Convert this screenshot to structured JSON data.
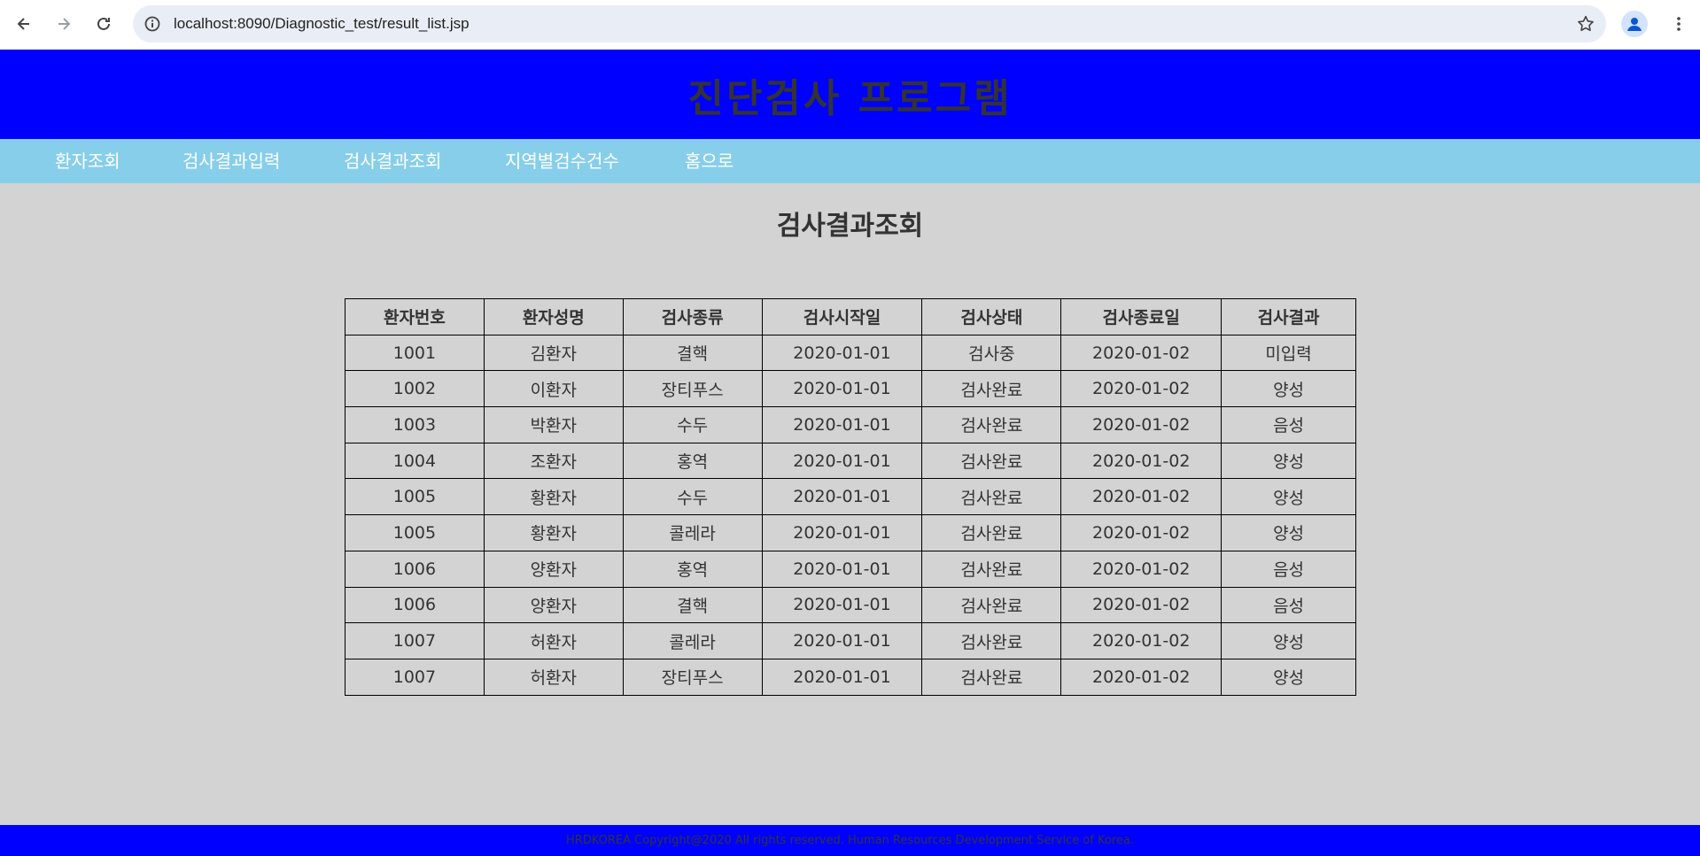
{
  "browser": {
    "url": "localhost:8090/Diagnostic_test/result_list.jsp"
  },
  "header": {
    "title": "진단검사 프로그램"
  },
  "nav": {
    "items": [
      "환자조회",
      "검사결과입력",
      "검사결과조회",
      "지역별검수건수",
      "홈으로"
    ]
  },
  "main": {
    "title": "검사결과조회",
    "table": {
      "headers": [
        "환자번호",
        "환자성명",
        "검사종류",
        "검사시작일",
        "검사상태",
        "검사종료일",
        "검사결과"
      ],
      "rows": [
        [
          "1001",
          "김환자",
          "결핵",
          "2020-01-01",
          "검사중",
          "2020-01-02",
          "미입력"
        ],
        [
          "1002",
          "이환자",
          "장티푸스",
          "2020-01-01",
          "검사완료",
          "2020-01-02",
          "양성"
        ],
        [
          "1003",
          "박환자",
          "수두",
          "2020-01-01",
          "검사완료",
          "2020-01-02",
          "음성"
        ],
        [
          "1004",
          "조환자",
          "홍역",
          "2020-01-01",
          "검사완료",
          "2020-01-02",
          "양성"
        ],
        [
          "1005",
          "황환자",
          "수두",
          "2020-01-01",
          "검사완료",
          "2020-01-02",
          "양성"
        ],
        [
          "1005",
          "황환자",
          "콜레라",
          "2020-01-01",
          "검사완료",
          "2020-01-02",
          "양성"
        ],
        [
          "1006",
          "양환자",
          "홍역",
          "2020-01-01",
          "검사완료",
          "2020-01-02",
          "음성"
        ],
        [
          "1006",
          "양환자",
          "결핵",
          "2020-01-01",
          "검사완료",
          "2020-01-02",
          "음성"
        ],
        [
          "1007",
          "허환자",
          "콜레라",
          "2020-01-01",
          "검사완료",
          "2020-01-02",
          "양성"
        ],
        [
          "1007",
          "허환자",
          "장티푸스",
          "2020-01-01",
          "검사완료",
          "2020-01-02",
          "양성"
        ]
      ]
    }
  },
  "footer": {
    "text": "HRDKOREA Copyright@2020 All rights reserved. Human Resources Development Service of Korea."
  },
  "colors": {
    "header_bg": "#0000ff",
    "nav_bg": "#87ceeb",
    "page_bg": "#d3d3d3",
    "text": "#333333"
  }
}
